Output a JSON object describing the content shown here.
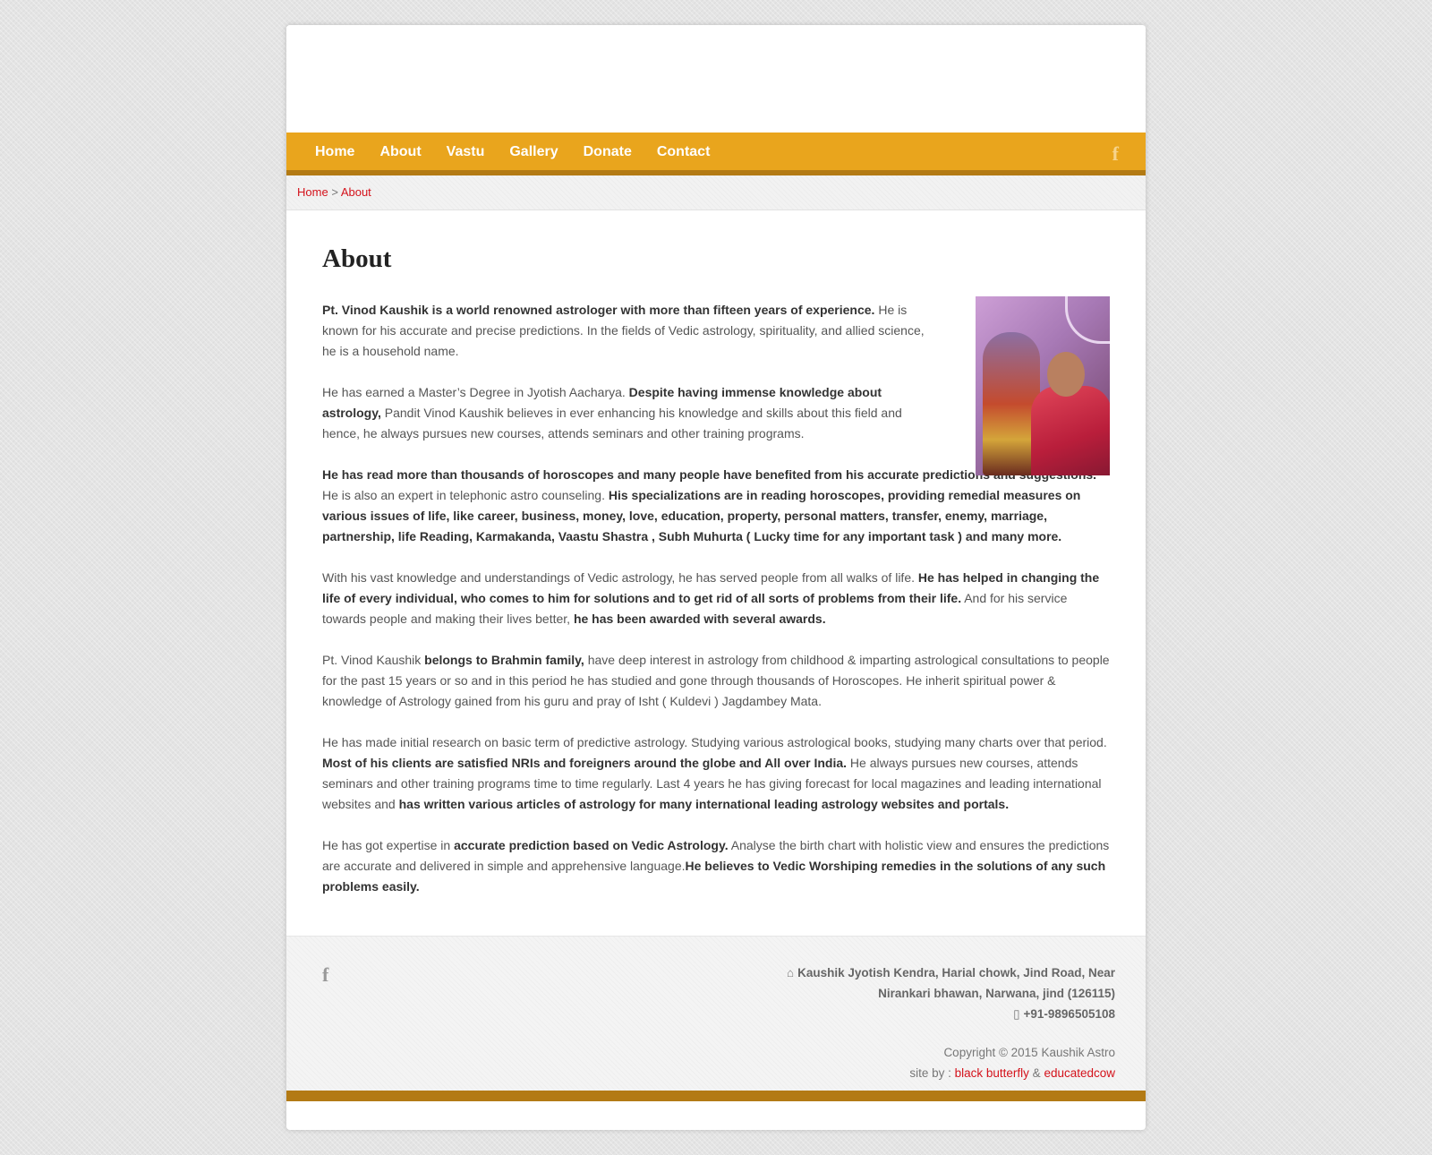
{
  "nav": {
    "items": [
      "Home",
      "About",
      "Vastu",
      "Gallery",
      "Donate",
      "Contact"
    ],
    "facebook_icon": "f"
  },
  "breadcrumb": {
    "home": "Home",
    "separator": ">",
    "current": "About"
  },
  "page": {
    "title": "About"
  },
  "paragraphs": {
    "p1_b1": "Pt. Vinod Kaushik is a world renowned astrologer with more than fifteen years of experience.",
    "p1_t1": " He is known for his accurate and precise predictions. In the fields of Vedic astrology, spirituality, and allied science, he is a household name.",
    "p2_t1": "He has earned a Master’s Degree in Jyotish Aacharya. ",
    "p2_b1": "Despite having immense knowledge about astrology,",
    "p2_t2": " Pandit Vinod Kaushik believes in ever enhancing his knowledge and skills about this field and hence, he always pursues new courses, attends seminars and other training programs.",
    "p3_b1": "He has read more than thousands of horoscopes and many people have benefited from his accurate predictions and suggestions.",
    "p3_t1": " He is also an expert in telephonic astro counseling. ",
    "p3_b2": "His specializations are in reading horoscopes, providing remedial measures on various issues of life, like career, business, money, love, education, property, personal matters, transfer, enemy, marriage, partnership, life Reading, Karmakanda, Vaastu Shastra , Subh Muhurta ( Lucky time for any important task ) and many more.",
    "p4_t1": "With his vast knowledge and understandings of Vedic astrology, he has served people from all walks of life. ",
    "p4_b1": "He has helped in changing the life of every individual, who comes to him for solutions and to get rid of all sorts of problems from their life.",
    "p4_t2": " And for his service towards people and making their lives better, ",
    "p4_b2": "he has been awarded with several awards.",
    "p5_t1": "Pt. Vinod Kaushik ",
    "p5_b1": "belongs to Brahmin family,",
    "p5_t2": " have deep interest in astrology from childhood & imparting astrological consultations to people for the past 15 years or so and in this period he has studied and gone through thousands of Horoscopes. He inherit spiritual power & knowledge of Astrology gained from his guru and pray of Isht ( Kuldevi ) Jagdambey Mata.",
    "p6_t1": "He has made initial research on basic term of predictive astrology. Studying various astrological books, studying many charts over that period. ",
    "p6_b1": "Most of his clients are satisfied NRIs and foreigners around the globe and All over India.",
    "p6_t2": " He always pursues new courses, attends seminars and other training programs time to time regularly. Last 4 years he has giving forecast for local magazines and leading international websites and ",
    "p6_b2": "has written various articles of astrology for many international leading astrology websites and portals.",
    "p7_t1": "He has got expertise in ",
    "p7_b1": "accurate prediction based on Vedic Astrology.",
    "p7_t2": " Analyse the birth chart with holistic view and ensures the predictions are accurate and delivered in simple and apprehensive language.",
    "p7_b2": "He believes to Vedic Worshiping remedies in the solutions of any such problems easily."
  },
  "footer": {
    "facebook_icon": "f",
    "address_line1": "Kaushik Jyotish Kendra, Harial chowk, Jind Road, Near",
    "address_line2": "Nirankari bhawan, Narwana, jind (126115)",
    "phone": "+91-9896505108",
    "copyright": "Copyright © 2015 Kaushik Astro",
    "site_by_label": "site by : ",
    "credit1": "black butterfly",
    "amp": " & ",
    "credit2": "educatedcow"
  },
  "colors": {
    "nav_bg": "#e9a51d",
    "nav_border": "#b37a14",
    "link": "#d4121b"
  }
}
